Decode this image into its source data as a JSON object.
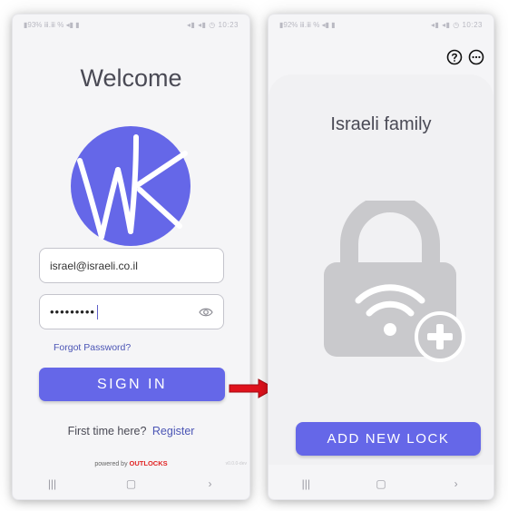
{
  "colors": {
    "accent": "#6567e8",
    "link": "#4b55b5",
    "brand": "#e12323",
    "arrow": "#e0121c",
    "lock_gray": "#c9c9cc"
  },
  "left_screen": {
    "status_bar": {
      "left": "▮93% ⅲ.ⅲ % ◂▮ ▮",
      "right": "◂▮ ◂▮ ◷ 10:23"
    },
    "title": "Welcome",
    "logo_icon": "wk-logo",
    "email_value": "israel@israeli.co.il",
    "password_value": "•••••••••",
    "password_toggle_icon": "eye-icon",
    "forgot_password": "Forgot Password?",
    "sign_in": "SIGN IN",
    "first_time": "First time here?",
    "register": "Register",
    "powered_by": "powered by",
    "brand": "OUTLOCKS",
    "version": "v0.0.0-dev",
    "nav": [
      "|||",
      "▢",
      "›"
    ]
  },
  "right_screen": {
    "status_bar": {
      "left": "▮92% ⅲ.ⅲ % ◂▮ ▮",
      "right": "◂▮ ◂▮ ◷ 10:23"
    },
    "help_icon": "help-circle-icon",
    "more_icon": "more-horizontal-icon",
    "family_name": "Israeli family",
    "lock_icon": "lock-wifi-plus-icon",
    "add_new_lock": "ADD NEW LOCK",
    "nav": [
      "|||",
      "▢",
      "›"
    ]
  }
}
